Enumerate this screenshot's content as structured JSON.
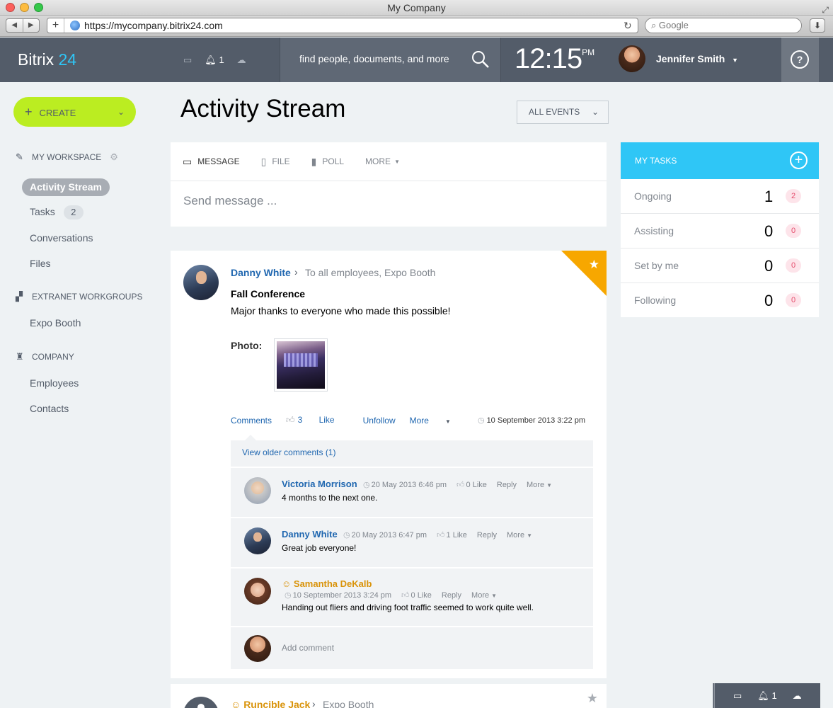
{
  "browser": {
    "title": "My Company",
    "url": "https://mycompany.bitrix24.com",
    "search_placeholder": "Google"
  },
  "header": {
    "logo_main": "Bitrix",
    "logo_accent": "24",
    "notifications_count": "1",
    "search_placeholder": "find people, documents, and more",
    "time": "12:15",
    "ampm": "PM",
    "user_name": "Jennifer Smith",
    "help_label": "?"
  },
  "sidebar": {
    "create_label": "CREATE",
    "workspace_label": "MY WORKSPACE",
    "items": [
      {
        "label": "Activity Stream"
      },
      {
        "label": "Tasks",
        "badge": "2"
      },
      {
        "label": "Conversations"
      },
      {
        "label": "Files"
      }
    ],
    "extranet_label": "EXTRANET WORKGROUPS",
    "extranet_items": [
      {
        "label": "Expo Booth"
      }
    ],
    "company_label": "COMPANY",
    "company_items": [
      {
        "label": "Employees"
      },
      {
        "label": "Contacts"
      }
    ]
  },
  "main": {
    "title": "Activity Stream",
    "filter_label": "ALL EVENTS",
    "composer": {
      "tabs": [
        "MESSAGE",
        "FILE",
        "POLL",
        "MORE"
      ],
      "placeholder": "Send message ..."
    },
    "post": {
      "author": "Danny White",
      "destination": "To all employees, Expo Booth",
      "title": "Fall Conference",
      "text": "Major thanks to everyone who made this possible!",
      "photo_label": "Photo:",
      "actions": {
        "comments": "Comments",
        "like_count": "3",
        "like": "Like",
        "unfollow": "Unfollow",
        "more": "More"
      },
      "date": "10 September 2013 3:22 pm",
      "older_comments": "View older comments (1)",
      "comments": [
        {
          "author": "Victoria Morrison",
          "date": "20 May 2013 6:46 pm",
          "likes": "0",
          "like": "Like",
          "reply": "Reply",
          "more": "More",
          "text": "4 months to the next one."
        },
        {
          "author": "Danny White",
          "date": "20 May 2013 6:47 pm",
          "likes": "1",
          "like": "Like",
          "reply": "Reply",
          "more": "More",
          "text": "Great job everyone!"
        },
        {
          "author": "Samantha DeKalb",
          "date": "10 September 2013 3:24 pm",
          "likes": "0",
          "like": "Like",
          "reply": "Reply",
          "more": "More",
          "text": "Handing out fliers and driving foot traffic seemed to work quite well."
        }
      ],
      "add_comment": "Add comment"
    },
    "next_post": {
      "author": "Runcible Jack",
      "destination": "Expo Booth"
    }
  },
  "tasks": {
    "title": "MY TASKS",
    "rows": [
      {
        "label": "Ongoing",
        "count": "1",
        "badge": "2"
      },
      {
        "label": "Assisting",
        "count": "0",
        "badge": "0"
      },
      {
        "label": "Set by me",
        "count": "0",
        "badge": "0"
      },
      {
        "label": "Following",
        "count": "0",
        "badge": "0"
      }
    ]
  },
  "bottom_bar": {
    "notifications_count": "1"
  },
  "colors": {
    "header": "#535c69",
    "accent": "#2fc6f6",
    "create": "#bbed21",
    "link": "#2067b0",
    "extranet": "#d9930a",
    "favorite": "#f7a700"
  }
}
